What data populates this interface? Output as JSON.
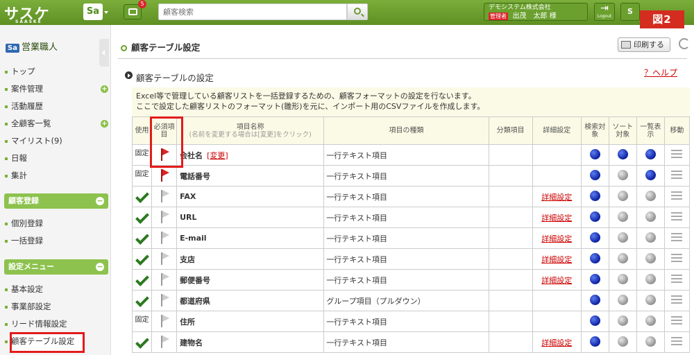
{
  "header": {
    "logo_text": "サスケ",
    "logo_sub": "SAASKE",
    "app_switch": "Sa",
    "notification_count": "5",
    "search_placeholder": "顧客検索",
    "company": "デモシステム株式会社",
    "admin_badge": "管理者",
    "user_name": "出茂　太郎 様",
    "logout_label": "Logout",
    "figure_label": "図2"
  },
  "sidebar": {
    "role": "営業職人",
    "role_badge": "Sa",
    "items": [
      {
        "label": "トップ"
      },
      {
        "label": "案件管理"
      },
      {
        "label": "活動履歴"
      },
      {
        "label": "全顧客一覧"
      },
      {
        "label": "マイリスト(9)"
      },
      {
        "label": "日報"
      },
      {
        "label": "集計"
      }
    ],
    "section_customer": "顧客登録",
    "customer_items": [
      {
        "label": "個別登録"
      },
      {
        "label": "一括登録"
      }
    ],
    "section_settings": "設定メニュー",
    "settings_items": [
      {
        "label": "基本設定"
      },
      {
        "label": "事業部設定"
      },
      {
        "label": "リード情報設定"
      },
      {
        "label": "顧客テーブル設定"
      }
    ]
  },
  "main": {
    "page_title": "顧客テーブル設定",
    "print_label": "印刷する",
    "subtitle": "顧客テーブルの設定",
    "help_label": "？ヘルプ",
    "description_line1": "Excel等で管理している顧客リストを一括登録するための、顧客フォーマットの設定を行ないます。",
    "description_line2": "ここで設定した顧客リストのフォーマット(雛形)を元に、インポート用のCSVファイルを作成します。"
  },
  "table": {
    "headers": {
      "use": "使用",
      "required": "必須項目",
      "name": "項目名称",
      "name_note": "(名前を変更する場合は[変更]をクリック)",
      "type": "項目の種類",
      "category": "分類項目",
      "detail": "詳細設定",
      "search": "検索対象",
      "sort": "ソート対象",
      "list": "一覧表示",
      "move": "移動"
    },
    "change_link": "[変更]",
    "rows": [
      {
        "use": "固定",
        "req": true,
        "name": "会社名",
        "type": "一行テキスト項目",
        "detail": "",
        "search": true,
        "sort": true,
        "list": true
      },
      {
        "use": "固定",
        "req": true,
        "name": "電話番号",
        "type": "一行テキスト項目",
        "detail": "",
        "search": true,
        "sort": false,
        "list": true
      },
      {
        "use": "check",
        "req": false,
        "name": "FAX",
        "type": "一行テキスト項目",
        "detail": "詳細設定",
        "search": true,
        "sort": false,
        "list": false
      },
      {
        "use": "check",
        "req": false,
        "name": "URL",
        "type": "一行テキスト項目",
        "detail": "詳細設定",
        "search": true,
        "sort": false,
        "list": false
      },
      {
        "use": "check",
        "req": false,
        "name": "E-mail",
        "type": "一行テキスト項目",
        "detail": "詳細設定",
        "search": true,
        "sort": false,
        "list": false
      },
      {
        "use": "check",
        "req": false,
        "name": "支店",
        "type": "一行テキスト項目",
        "detail": "詳細設定",
        "search": true,
        "sort": false,
        "list": false
      },
      {
        "use": "check",
        "req": false,
        "name": "郵便番号",
        "type": "一行テキスト項目",
        "detail": "詳細設定",
        "search": true,
        "sort": false,
        "list": false
      },
      {
        "use": "check",
        "req": false,
        "name": "都道府県",
        "type": "グループ項目（プルダウン）",
        "detail": "",
        "search": true,
        "sort": false,
        "list": false
      },
      {
        "use": "固定",
        "req": false,
        "name": "住所",
        "type": "一行テキスト項目",
        "detail": "",
        "search": true,
        "sort": false,
        "list": false
      },
      {
        "use": "check",
        "req": false,
        "name": "建物名",
        "type": "一行テキスト項目",
        "detail": "詳細設定",
        "search": true,
        "sort": false,
        "list": false
      }
    ]
  }
}
